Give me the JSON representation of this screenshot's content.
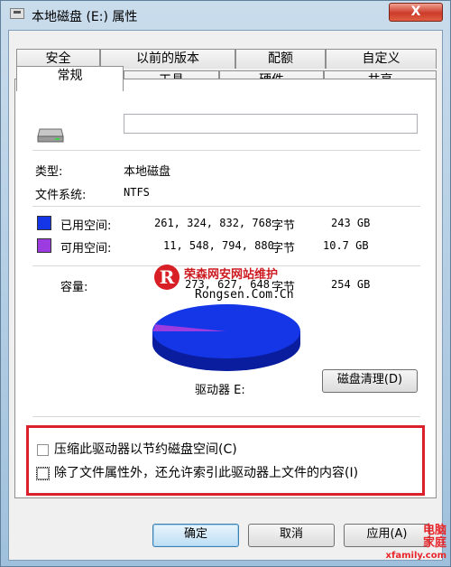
{
  "window": {
    "title": "本地磁盘 (E:) 属性",
    "close_label": "X"
  },
  "tabs": {
    "row1": [
      "安全",
      "以前的版本",
      "配额",
      "自定义"
    ],
    "row2": [
      "常规",
      "工具",
      "硬件",
      "共享"
    ],
    "active": "常规"
  },
  "general": {
    "drive_name_value": "",
    "type_label": "类型:",
    "type_value": "本地磁盘",
    "fs_label": "文件系统:",
    "fs_value": "NTFS",
    "used": {
      "label": "已用空间:",
      "bytes": "261, 324, 832, 768",
      "unit": "字节",
      "size": "243 GB",
      "color": "#1436e6"
    },
    "free": {
      "label": "可用空间:",
      "bytes": "11, 548, 794, 880",
      "unit": "字节",
      "size": "10.7 GB",
      "color": "#9c3be0"
    },
    "capacity": {
      "label": "容量:",
      "bytes": "273, 627, 648",
      "unit": "字节",
      "size": "254 GB"
    },
    "drive_label": "驱动器 E:",
    "cleanup_button": "磁盘清理(D)",
    "compress_checkbox": "压缩此驱动器以节约磁盘空间(C)",
    "index_checkbox": "除了文件属性外，还允许索引此驱动器上文件的内容(I)",
    "used_fraction": 0.958
  },
  "footer": {
    "ok": "确定",
    "cancel": "取消",
    "apply": "应用(A)"
  },
  "watermark": {
    "logo_letter": "R",
    "line1": "荣森网安网站维护",
    "line2": "Rongsen.Com.Cn",
    "corner1": "电脑",
    "corner2": "家庭",
    "corner3": "xfamily.com"
  }
}
